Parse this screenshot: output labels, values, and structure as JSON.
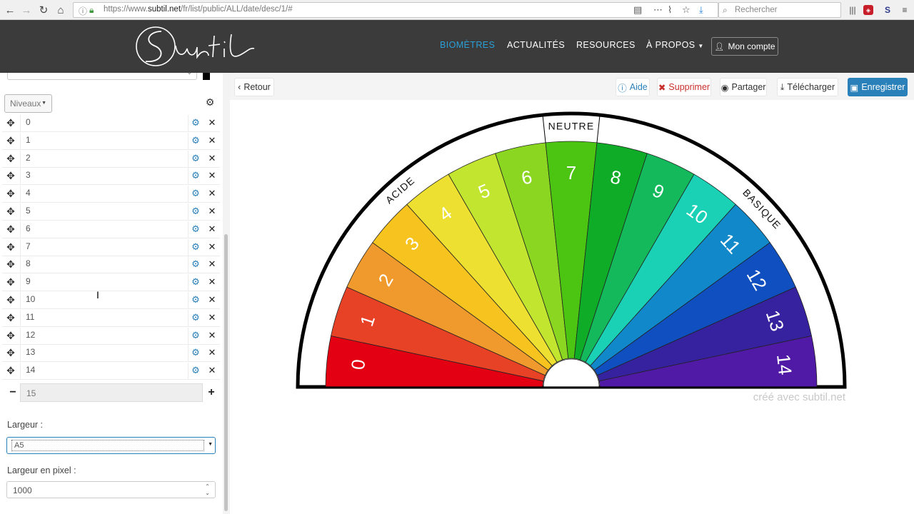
{
  "browser": {
    "url_prefix": "https://www.",
    "url_domain": "subtil.net",
    "url_path": "/fr/list/public/ALL/date/desc/1/#",
    "search_placeholder": "Rechercher"
  },
  "header": {
    "logo_text": "Subtil",
    "nav": {
      "biometres": "BIOMÈTRES",
      "actualites": "ACTUALITÉS",
      "resources": "RESOURCES",
      "apropos": "À PROPOS"
    },
    "account_label": "Mon compte"
  },
  "sidebar": {
    "levels_dropdown_label": "Niveaux",
    "levels": [
      "0",
      "1",
      "2",
      "3",
      "4",
      "5",
      "6",
      "7",
      "8",
      "9",
      "10",
      "11",
      "12",
      "13",
      "14"
    ],
    "count_value": "15",
    "width_label": "Largeur :",
    "width_value": "A5",
    "pixel_width_label": "Largeur en pixel :",
    "pixel_width_value": "1000"
  },
  "toolbar": {
    "back_label": "Retour",
    "help_label": "Aide",
    "delete_label": "Supprimer",
    "share_label": "Partager",
    "download_label": "Télécharger",
    "save_label": "Enregistrer"
  },
  "chart_data": {
    "type": "pie",
    "shape": "semicircle",
    "segments": [
      "0",
      "1",
      "2",
      "3",
      "4",
      "5",
      "6",
      "7",
      "8",
      "9",
      "10",
      "11",
      "12",
      "13",
      "14"
    ],
    "values": [
      1,
      1,
      1,
      1,
      1,
      1,
      1,
      1,
      1,
      1,
      1,
      1,
      1,
      1,
      1
    ],
    "colors": [
      "#e30012",
      "#e84226",
      "#f09a2d",
      "#f6c31f",
      "#ede031",
      "#c2e530",
      "#8bd620",
      "#4cc512",
      "#0fac27",
      "#14b95b",
      "#1ad0b5",
      "#1088c9",
      "#104fbf",
      "#36229f",
      "#5019a6",
      "#3c1478"
    ],
    "ring_labels": {
      "acid": "ACIDE",
      "neutral": "NEUTRE",
      "basic": "BASIQUE"
    },
    "credit": "créé avec subtil.net"
  }
}
